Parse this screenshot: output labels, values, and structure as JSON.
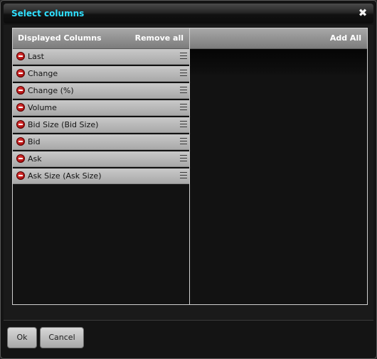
{
  "dialog": {
    "title": "Select columns",
    "close_glyph": "✖",
    "title_color": "#2fe0ff"
  },
  "displayed_panel": {
    "title": "Displayed Columns",
    "action_label": "Remove all",
    "items": [
      {
        "label": "Last",
        "icon": "remove-icon"
      },
      {
        "label": "Change",
        "icon": "remove-icon"
      },
      {
        "label": "Change (%)",
        "icon": "remove-icon"
      },
      {
        "label": "Volume",
        "icon": "remove-icon"
      },
      {
        "label": "Bid Size (Bid Size)",
        "icon": "remove-icon"
      },
      {
        "label": "Bid",
        "icon": "remove-icon"
      },
      {
        "label": "Ask",
        "icon": "remove-icon"
      },
      {
        "label": "Ask Size (Ask Size)",
        "icon": "remove-icon"
      }
    ]
  },
  "available_panel": {
    "action_label": "Add All",
    "items": []
  },
  "footer": {
    "ok_label": "Ok",
    "cancel_label": "Cancel"
  }
}
